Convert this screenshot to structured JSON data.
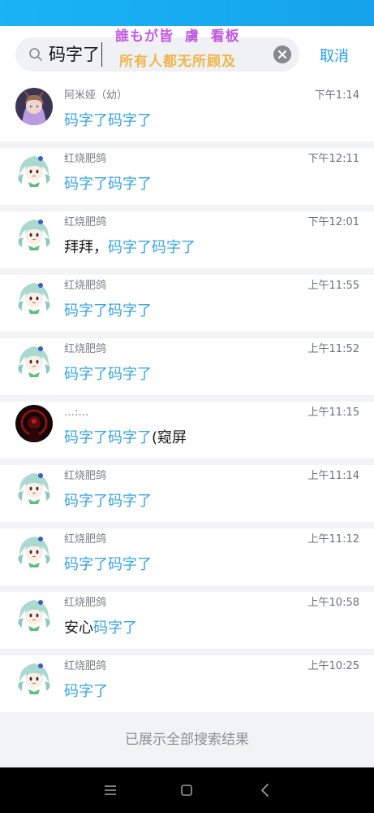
{
  "search": {
    "query": "码字了",
    "cancel_label": "取消"
  },
  "watermark": {
    "line1": "誰もが皆  虜  看板",
    "line2": "所有人都无所顾及"
  },
  "results": [
    {
      "sender": "阿米娅（幼）",
      "time": "下午1:14",
      "avatar": "amiya-avatar",
      "parts": [
        {
          "t": "码字了码字了",
          "hl": true
        }
      ]
    },
    {
      "sender": "红烧肥鸽",
      "time": "下午12:11",
      "avatar": "green-hair-avatar",
      "parts": [
        {
          "t": "码字了码字了",
          "hl": true
        }
      ]
    },
    {
      "sender": "红烧肥鸽",
      "time": "下午12:01",
      "avatar": "green-hair-avatar",
      "parts": [
        {
          "t": "拜拜，",
          "hl": false
        },
        {
          "t": "码字了码字了",
          "hl": true
        }
      ]
    },
    {
      "sender": "红烧肥鸽",
      "time": "上午11:55",
      "avatar": "green-hair-avatar",
      "parts": [
        {
          "t": "码字了码字了",
          "hl": true
        }
      ]
    },
    {
      "sender": "红烧肥鸽",
      "time": "上午11:52",
      "avatar": "green-hair-avatar",
      "parts": [
        {
          "t": "码字了码字了",
          "hl": true
        }
      ]
    },
    {
      "sender": "…:…",
      "time": "上午11:15",
      "avatar": "dark-red-avatar",
      "parts": [
        {
          "t": "码字了码字了",
          "hl": true
        },
        {
          "t": "(窥屏",
          "hl": false
        }
      ]
    },
    {
      "sender": "红烧肥鸽",
      "time": "上午11:14",
      "avatar": "green-hair-avatar",
      "parts": [
        {
          "t": "码字了码字了",
          "hl": true
        }
      ]
    },
    {
      "sender": "红烧肥鸽",
      "time": "上午11:12",
      "avatar": "green-hair-avatar",
      "parts": [
        {
          "t": "码字了码字了",
          "hl": true
        }
      ]
    },
    {
      "sender": "红烧肥鸽",
      "time": "上午10:58",
      "avatar": "green-hair-avatar",
      "parts": [
        {
          "t": "安心",
          "hl": false
        },
        {
          "t": "码字了",
          "hl": true
        }
      ]
    },
    {
      "sender": "红烧肥鸽",
      "time": "上午10:25",
      "avatar": "green-hair-avatar",
      "parts": [
        {
          "t": "码字了",
          "hl": true
        }
      ]
    }
  ],
  "footer": {
    "all_results_text": "已展示全部搜索结果"
  },
  "navigation": {
    "buttons": [
      "menu-icon",
      "home-icon",
      "back-icon"
    ]
  },
  "colors": {
    "accent": "#1f9ee8",
    "highlight": "#3aa4de",
    "status_bar": "#14a3ec"
  }
}
